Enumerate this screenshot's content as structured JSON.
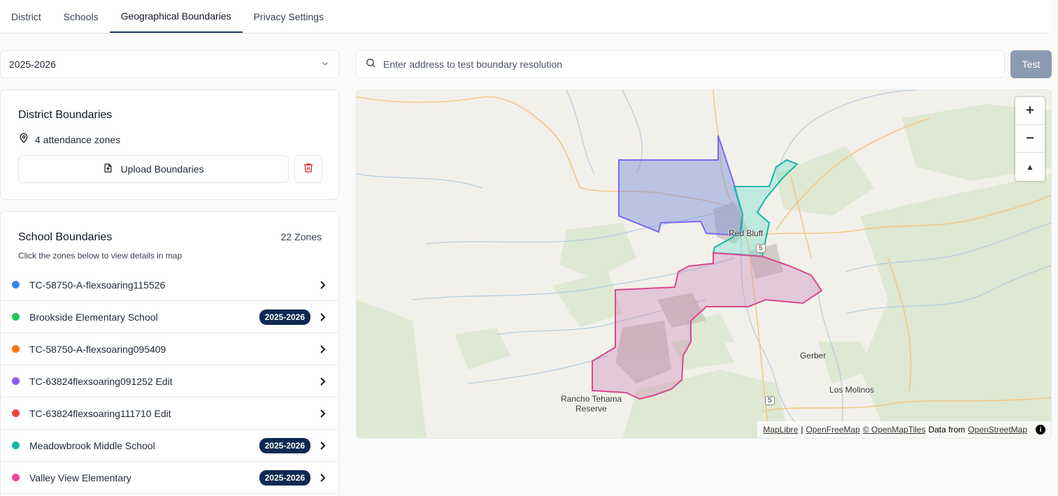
{
  "tabs": [
    {
      "label": "District"
    },
    {
      "label": "Schools"
    },
    {
      "label": "Geographical Boundaries"
    },
    {
      "label": "Privacy Settings"
    }
  ],
  "year_select": {
    "value": "2025-2026"
  },
  "search": {
    "placeholder": "Enter address to test boundary resolution",
    "button": "Test"
  },
  "district": {
    "title": "District Boundaries",
    "zones_text": "4 attendance zones",
    "upload_label": "Upload Boundaries"
  },
  "schools": {
    "title": "School Boundaries",
    "count": "22 Zones",
    "hint": "Click the zones below to view details in map",
    "items": [
      {
        "name": "TC-58750-A-flexsoaring115526",
        "color": "#3b82f6",
        "badge": ""
      },
      {
        "name": "Brookside Elementary School",
        "color": "#22c55e",
        "badge": "2025-2026"
      },
      {
        "name": "TC-58750-A-flexsoaring095409",
        "color": "#f97316",
        "badge": ""
      },
      {
        "name": "TC-63824flexsoaring091252 Edit",
        "color": "#8b5cf6",
        "badge": ""
      },
      {
        "name": "TC-63824flexsoaring111710 Edit",
        "color": "#ef4444",
        "badge": ""
      },
      {
        "name": "Meadowbrook Middle School",
        "color": "#14b8a6",
        "badge": "2025-2026"
      },
      {
        "name": "Valley View Elementary",
        "color": "#ec4899",
        "badge": "2025-2026"
      }
    ]
  },
  "map": {
    "labels": {
      "red_bluff": "Red Bluff",
      "gerber": "Gerber",
      "los_molinos": "Los Molinos",
      "rancho_tehama": "Rancho Tehama",
      "reserve": "Reserve",
      "highway_1": "5",
      "highway_2": "5"
    },
    "controls": {
      "zoom_in": "+",
      "zoom_out": "−",
      "compass": "▲"
    },
    "attribution": {
      "maplibre": "MapLibre",
      "sep": "|",
      "openfreemap": "OpenFreeMap",
      "openmaptiles": "© OpenMapTiles",
      "data_from": "Data from",
      "osm": "OpenStreetMap",
      "info": "i"
    }
  }
}
